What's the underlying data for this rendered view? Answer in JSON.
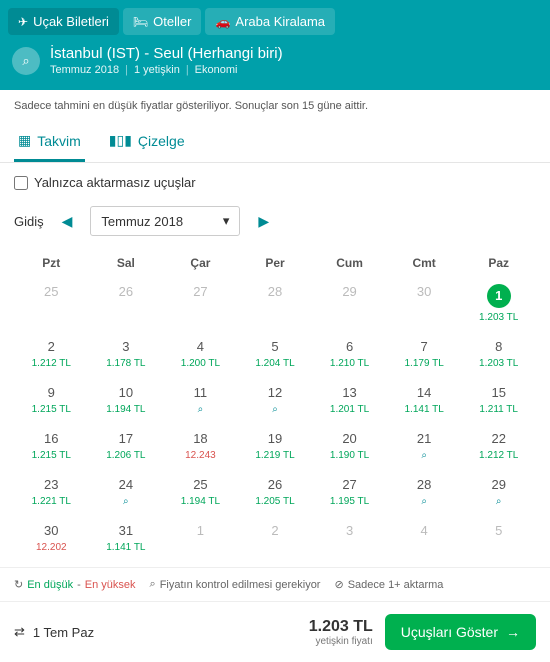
{
  "nav": {
    "flights": "Uçak Biletleri",
    "hotels": "Oteller",
    "cars": "Araba Kiralama"
  },
  "search": {
    "title": "İstanbul (IST) - Seul (Herhangi biri)",
    "month": "Temmuz 2018",
    "pax": "1 yetişkin",
    "cabin": "Ekonomi"
  },
  "info": "Sadece tahmini en düşük fiyatlar gösteriliyor. Sonuçlar son 15 güne aittir.",
  "views": {
    "calendar": "Takvim",
    "chart": "Çizelge"
  },
  "filters": {
    "direct_only": "Yalnızca aktarmasız uçuşlar",
    "direction": "Gidiş",
    "month_value": "Temmuz 2018"
  },
  "weekdays": [
    "Pzt",
    "Sal",
    "Çar",
    "Per",
    "Cum",
    "Cmt",
    "Paz"
  ],
  "cells": [
    {
      "d": "25",
      "dim": true
    },
    {
      "d": "26",
      "dim": true
    },
    {
      "d": "27",
      "dim": true
    },
    {
      "d": "28",
      "dim": true
    },
    {
      "d": "29",
      "dim": true
    },
    {
      "d": "30",
      "dim": true
    },
    {
      "d": "1",
      "sel": true,
      "p": "1.203 TL",
      "cls": "low"
    },
    {
      "d": "2",
      "p": "1.212 TL",
      "cls": "low"
    },
    {
      "d": "3",
      "p": "1.178 TL",
      "cls": "low"
    },
    {
      "d": "4",
      "p": "1.200 TL",
      "cls": "low"
    },
    {
      "d": "5",
      "p": "1.204 TL",
      "cls": "low"
    },
    {
      "d": "6",
      "p": "1.210 TL",
      "cls": "low"
    },
    {
      "d": "7",
      "p": "1.179 TL",
      "cls": "low"
    },
    {
      "d": "8",
      "p": "1.203 TL",
      "cls": "low"
    },
    {
      "d": "9",
      "p": "1.215 TL",
      "cls": "low"
    },
    {
      "d": "10",
      "p": "1.194 TL",
      "cls": "low"
    },
    {
      "d": "11",
      "mag": true
    },
    {
      "d": "12",
      "mag": true
    },
    {
      "d": "13",
      "p": "1.201 TL",
      "cls": "low"
    },
    {
      "d": "14",
      "p": "1.141 TL",
      "cls": "low"
    },
    {
      "d": "15",
      "p": "1.211 TL",
      "cls": "low"
    },
    {
      "d": "16",
      "p": "1.215 TL",
      "cls": "low"
    },
    {
      "d": "17",
      "p": "1.206 TL",
      "cls": "low"
    },
    {
      "d": "18",
      "p": "12.243",
      "cls": "hi"
    },
    {
      "d": "19",
      "p": "1.219 TL",
      "cls": "low"
    },
    {
      "d": "20",
      "p": "1.190 TL",
      "cls": "low"
    },
    {
      "d": "21",
      "mag": true
    },
    {
      "d": "22",
      "p": "1.212 TL",
      "cls": "low"
    },
    {
      "d": "23",
      "p": "1.221 TL",
      "cls": "low"
    },
    {
      "d": "24",
      "mag": true
    },
    {
      "d": "25",
      "p": "1.194 TL",
      "cls": "low"
    },
    {
      "d": "26",
      "p": "1.205 TL",
      "cls": "low"
    },
    {
      "d": "27",
      "p": "1.195 TL",
      "cls": "low"
    },
    {
      "d": "28",
      "mag": true
    },
    {
      "d": "29",
      "mag": true
    },
    {
      "d": "30",
      "p": "12.202",
      "cls": "hi"
    },
    {
      "d": "31",
      "p": "1.141 TL",
      "cls": "low"
    },
    {
      "d": "1",
      "dim": true
    },
    {
      "d": "2",
      "dim": true
    },
    {
      "d": "3",
      "dim": true
    },
    {
      "d": "4",
      "dim": true
    },
    {
      "d": "5",
      "dim": true
    }
  ],
  "legend": {
    "low": "En düşük",
    "hi": "En yüksek",
    "check": "Fiyatın kontrol edilmesi gerekiyor",
    "transfer": "Sadece 1+ aktarma"
  },
  "footer": {
    "date": "1 Tem Paz",
    "price": "1.203 TL",
    "sub": "yetişkin fiyatı",
    "cta": "Uçuşları Göster"
  }
}
